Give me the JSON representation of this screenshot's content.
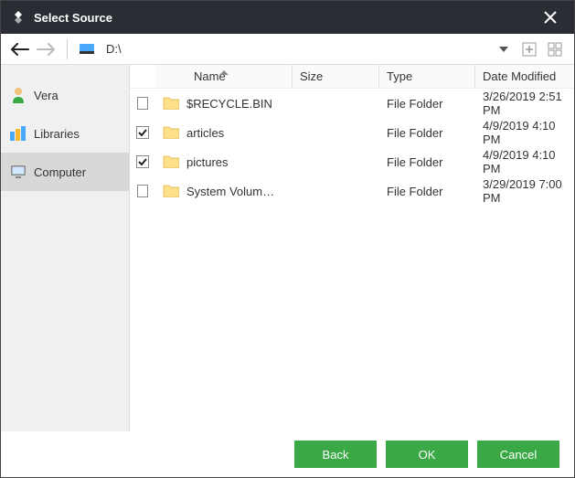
{
  "window": {
    "title": "Select Source"
  },
  "toolbar": {
    "path": "D:\\"
  },
  "sidebar": {
    "items": [
      {
        "label": "Vera"
      },
      {
        "label": "Libraries"
      },
      {
        "label": "Computer"
      }
    ]
  },
  "columns": {
    "name": "Name",
    "size": "Size",
    "type": "Type",
    "date": "Date Modified"
  },
  "files": [
    {
      "checked": false,
      "name": "$RECYCLE.BIN",
      "size": "",
      "type": "File Folder",
      "date": "3/26/2019 2:51 PM"
    },
    {
      "checked": true,
      "name": "articles",
      "size": "",
      "type": "File Folder",
      "date": "4/9/2019 4:10 PM"
    },
    {
      "checked": true,
      "name": "pictures",
      "size": "",
      "type": "File Folder",
      "date": "4/9/2019 4:10 PM"
    },
    {
      "checked": false,
      "name": "System Volum…",
      "size": "",
      "type": "File Folder",
      "date": "3/29/2019 7:00 PM"
    }
  ],
  "buttons": {
    "back": "Back",
    "ok": "OK",
    "cancel": "Cancel"
  }
}
